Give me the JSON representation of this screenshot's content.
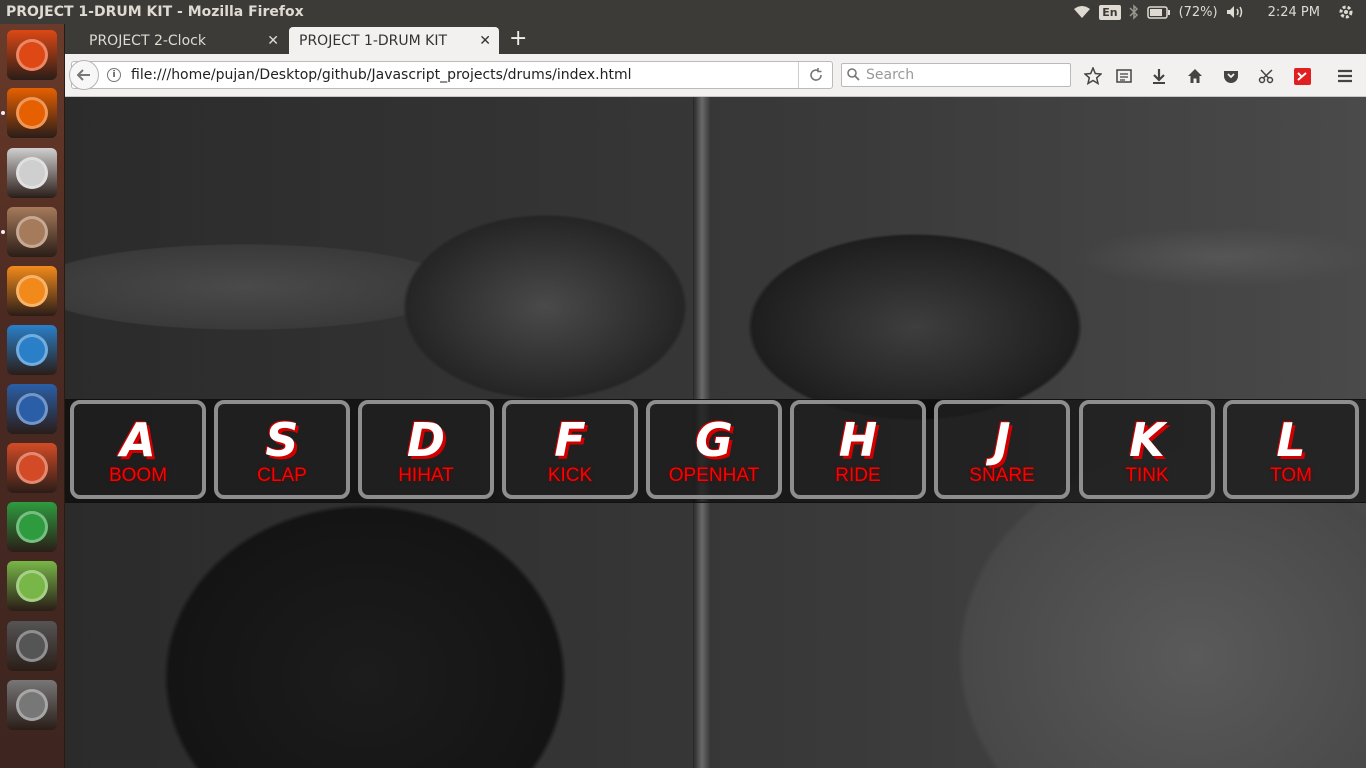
{
  "window": {
    "title": "PROJECT 1-DRUM KIT - Mozilla Firefox"
  },
  "panel": {
    "keyboard_layout": "En",
    "battery": "(72%)",
    "clock": "2:24 PM"
  },
  "launcher": {
    "apps": [
      {
        "name": "ubuntu-dash",
        "color": "#dd4814"
      },
      {
        "name": "firefox",
        "color": "#e66000"
      },
      {
        "name": "text-editor",
        "color": "#cfcfcf"
      },
      {
        "name": "files",
        "color": "#a67b5b"
      },
      {
        "name": "sublime-text",
        "color": "#f28a1b"
      },
      {
        "name": "brackets",
        "color": "#2a80c8"
      },
      {
        "name": "libreoffice-writer",
        "color": "#2a5fa8"
      },
      {
        "name": "libreoffice-impress",
        "color": "#d34b26"
      },
      {
        "name": "libreoffice-calc",
        "color": "#2f9b3f"
      },
      {
        "name": "android-studio",
        "color": "#78b648"
      },
      {
        "name": "workspace-switcher",
        "color": "#555"
      },
      {
        "name": "app-stack",
        "color": "#777"
      }
    ]
  },
  "tabs": [
    {
      "label": "PROJECT 2-Clock",
      "active": false
    },
    {
      "label": "PROJECT 1-DRUM KIT",
      "active": true
    }
  ],
  "navbar": {
    "url": "file:///home/pujan/Desktop/github/Javascript_projects/drums/index.html",
    "search_placeholder": "Search"
  },
  "drum_keys": [
    {
      "key": "A",
      "sound": "BOOM"
    },
    {
      "key": "S",
      "sound": "CLAP"
    },
    {
      "key": "D",
      "sound": "HIHAT"
    },
    {
      "key": "F",
      "sound": "KICK"
    },
    {
      "key": "G",
      "sound": "OPENHAT"
    },
    {
      "key": "H",
      "sound": "RIDE"
    },
    {
      "key": "J",
      "sound": "SNARE"
    },
    {
      "key": "K",
      "sound": "TINK"
    },
    {
      "key": "L",
      "sound": "TOM"
    }
  ]
}
